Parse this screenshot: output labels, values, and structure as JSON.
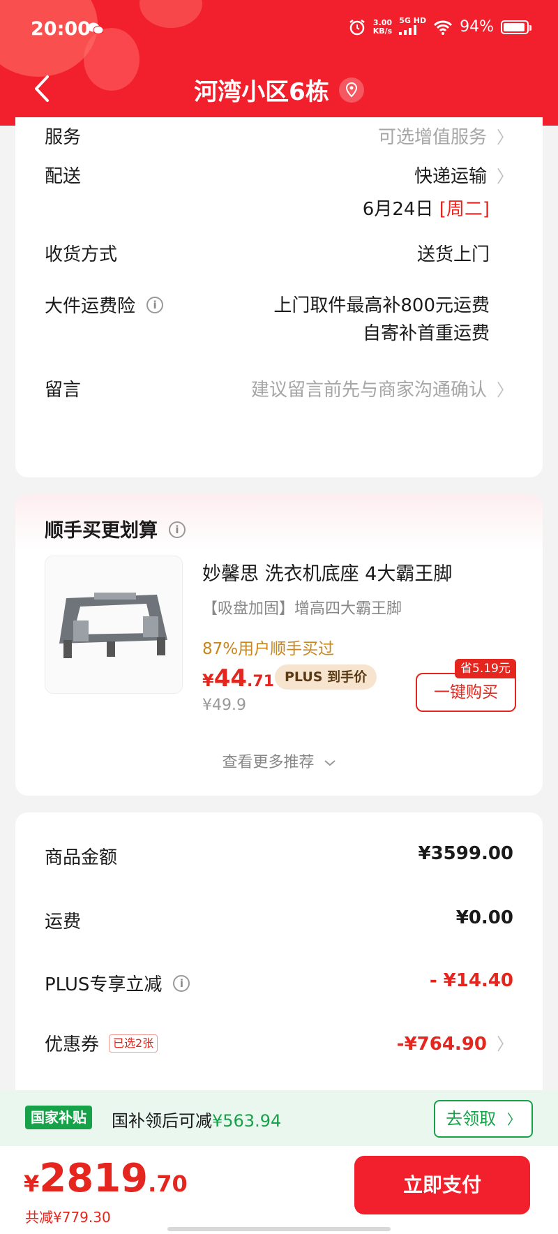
{
  "status_bar": {
    "time": "20:00",
    "net_speed_value": "3.00",
    "net_speed_unit": "KB/s",
    "network": "5G HD",
    "battery": "94%",
    "battery_level": 0.94
  },
  "header": {
    "title": "河湾小区6栋"
  },
  "order_info": {
    "service": {
      "label": "服务",
      "value": "可选增值服务"
    },
    "delivery": {
      "label": "配送",
      "value": "快递运输",
      "date": "6月24日",
      "weekday": "[周二]"
    },
    "receive_method": {
      "label": "收货方式",
      "value": "送货上门"
    },
    "shipping_insurance": {
      "label": "大件运费险",
      "line1": "上门取件最高补800元运费",
      "line2": "自寄补首重运费"
    },
    "message": {
      "label": "留言",
      "placeholder": "建议留言前先与商家沟通确认"
    }
  },
  "recommend": {
    "title": "顺手买更划算",
    "product": {
      "name": "妙馨思 洗衣机底座 4大霸王脚",
      "subtitle": "【吸盘加固】增高四大霸王脚",
      "bought": "87%用户顺手买过",
      "currency": "¥",
      "price_int": "44",
      "price_dec": ".71",
      "plus_label": "PLUS 到手价",
      "original_price": "¥49.9",
      "save_label": "省5.19元",
      "buy_label": "一键购买"
    },
    "more_label": "查看更多推荐"
  },
  "totals": {
    "goods": {
      "label": "商品金额",
      "value": "¥3599.00"
    },
    "shipping": {
      "label": "运费",
      "value": "¥0.00"
    },
    "plus_discount": {
      "label": "PLUS专享立减",
      "value": "- ¥14.40"
    },
    "coupon": {
      "label": "优惠券",
      "tag": "已选2张",
      "value": "-¥764.90"
    }
  },
  "subsidy": {
    "badge": "国家补贴",
    "text": "国补领后可减",
    "amount": "¥563.94",
    "button": "去领取"
  },
  "bottom": {
    "currency": "¥",
    "total_int": "2819",
    "total_dec": ".70",
    "saved": "共减¥779.30",
    "pay_label": "立即支付"
  },
  "colors": {
    "brand_red": "#f2202c",
    "price_red": "#e4261e",
    "subsidy_green": "#17a24a",
    "plus_gold": "#c8861c"
  }
}
